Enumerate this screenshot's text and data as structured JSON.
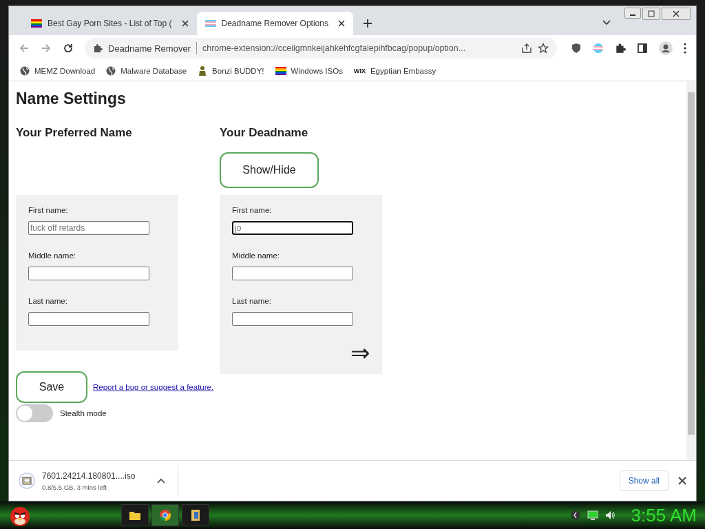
{
  "tabs": [
    {
      "title": "Best Gay Porn Sites - List of Top (",
      "kind": "rainbow",
      "selected": false
    },
    {
      "title": "Deadname Remover Options",
      "kind": "trans",
      "selected": true
    }
  ],
  "address_bar": {
    "site": "Deadname Remover",
    "url": "chrome-extension://cceilgmnkeijahkehfcgfalepihfbcag/popup/option..."
  },
  "bookmarks": [
    {
      "label": "MEMZ Download",
      "kind": "globe"
    },
    {
      "label": "Malware Database",
      "kind": "globe"
    },
    {
      "label": "Bonzi BUDDY!",
      "kind": "figure"
    },
    {
      "label": "Windows ISOs",
      "kind": "rainbow"
    },
    {
      "label": "Egyptian Embassy",
      "kind": "wix",
      "logo_text": "WIX"
    }
  ],
  "page": {
    "title": "Name Settings",
    "columns": [
      {
        "heading": "Your Preferred Name",
        "fields": [
          {
            "label": "First name:",
            "placeholder": "fuck off retards",
            "focused": false
          },
          {
            "label": "Middle name:",
            "focused": false
          },
          {
            "label": "Last name:",
            "focused": false
          }
        ]
      },
      {
        "heading": "Your Deadname",
        "toggle_button": "Show/Hide",
        "next_arrow": "⇒",
        "fields": [
          {
            "label": "First name:",
            "placeholder": "jo",
            "focused": true
          },
          {
            "label": "Middle name:",
            "focused": false
          },
          {
            "label": "Last name:",
            "focused": false
          }
        ]
      }
    ],
    "save_button": "Save",
    "report_link": "Report a bug or suggest a feature.",
    "toggles": [
      {
        "label": "Stealth mode",
        "on": false
      }
    ]
  },
  "download_bar": {
    "file": "7601.24214.180801....iso",
    "status": "0.8/5.5 GB, 3 mins left",
    "show_all": "Show all"
  },
  "taskbar": {
    "clock": "3:55 AM"
  }
}
